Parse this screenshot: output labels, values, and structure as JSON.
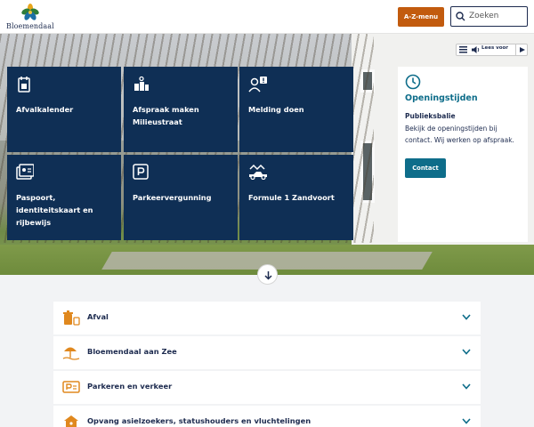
{
  "header": {
    "logo_text": "Bloemendaal",
    "az_label": "A-Z-menu",
    "search_placeholder": "Zoeken"
  },
  "tiles": [
    {
      "label": "Afvalkalender",
      "icon": "calendar-bin-icon"
    },
    {
      "label": "Afspraak maken Milieustraat",
      "icon": "recycling-station-icon"
    },
    {
      "label": "Melding doen",
      "icon": "report-person-icon"
    },
    {
      "label": "Paspoort, identiteitskaart en rijbewijs",
      "icon": "id-card-icon"
    },
    {
      "label": "Parkeervergunning",
      "icon": "parking-icon"
    },
    {
      "label": "Formule 1 Zandvoort",
      "icon": "race-car-icon"
    }
  ],
  "readspeaker": {
    "label": "Lees voor"
  },
  "opening": {
    "title": "Openingstijden",
    "subtitle": "Publieksbalie",
    "text": "Bekijk de openingstijden bij contact. Wij werken op afspraak.",
    "button": "Contact"
  },
  "accordion": [
    {
      "label": "Afval",
      "icon": "waste-icon"
    },
    {
      "label": "Bloemendaal aan Zee",
      "icon": "beach-umbrella-icon"
    },
    {
      "label": "Parkeren en verkeer",
      "icon": "parking-sign-icon"
    },
    {
      "label": "Opvang asielzoekers, statushouders en vluchtelingen",
      "icon": "refugee-shelter-icon"
    }
  ],
  "colors": {
    "navy": "#0f2f55",
    "orange": "#c25b0e",
    "teal": "#0e6d8a",
    "icon_orange": "#e0881e"
  }
}
